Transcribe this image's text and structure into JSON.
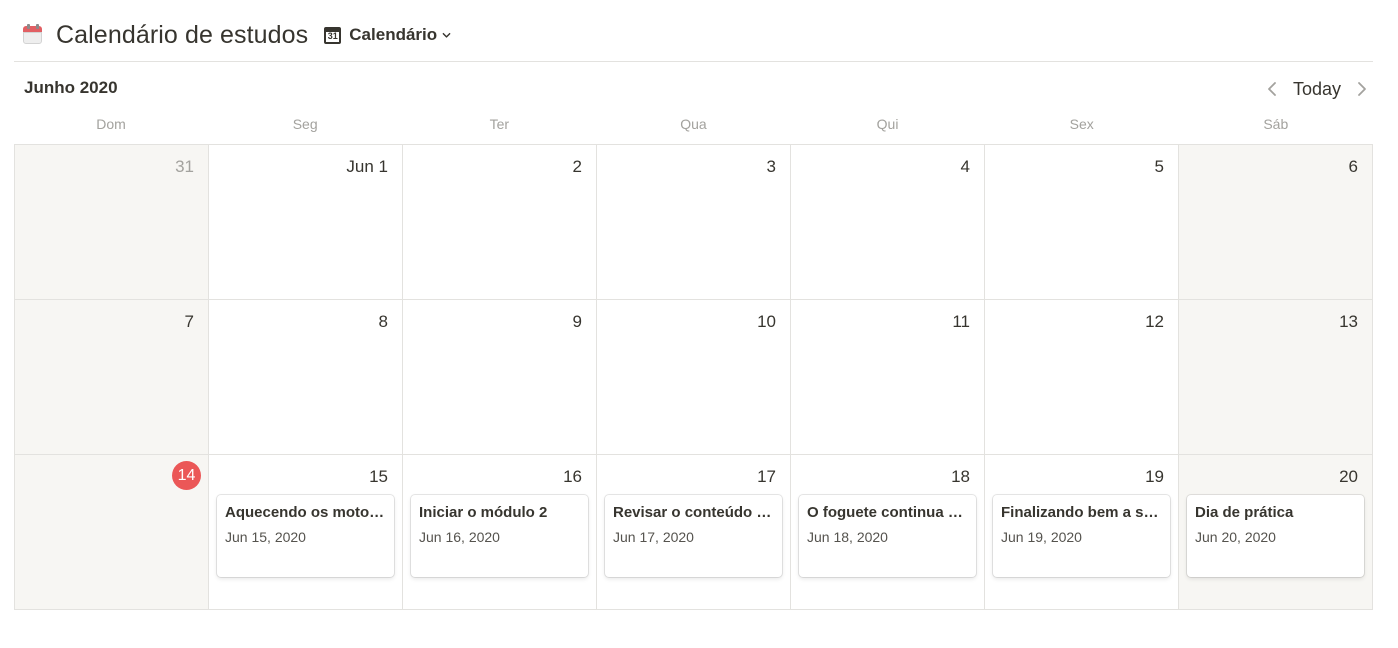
{
  "header": {
    "page_icon": "calendar-emoji-icon",
    "title": "Calendário de estudos",
    "view": {
      "icon": "calendar-view-icon",
      "icon_text": "31",
      "label": "Calendário"
    }
  },
  "calendar": {
    "month_label": "Junho 2020",
    "today_label": "Today",
    "weekdays": [
      "Dom",
      "Seg",
      "Ter",
      "Qua",
      "Qui",
      "Sex",
      "Sáb"
    ],
    "weeks": [
      [
        {
          "day": "31",
          "muted": true
        },
        {
          "day": "Jun 1"
        },
        {
          "day": "2"
        },
        {
          "day": "3"
        },
        {
          "day": "4"
        },
        {
          "day": "5"
        },
        {
          "day": "6"
        }
      ],
      [
        {
          "day": "7"
        },
        {
          "day": "8"
        },
        {
          "day": "9"
        },
        {
          "day": "10"
        },
        {
          "day": "11"
        },
        {
          "day": "12"
        },
        {
          "day": "13"
        }
      ],
      [
        {
          "day": "14",
          "today": true
        },
        {
          "day": "15",
          "event": {
            "title": "Aquecendo os motores",
            "date": "Jun 15, 2020"
          }
        },
        {
          "day": "16",
          "event": {
            "title": "Iniciar o módulo 2",
            "date": "Jun 16, 2020"
          }
        },
        {
          "day": "17",
          "event": {
            "title": "Revisar o conteúdo q...",
            "date": "Jun 17, 2020"
          }
        },
        {
          "day": "18",
          "event": {
            "title": "O foguete continua su...",
            "date": "Jun 18, 2020"
          }
        },
        {
          "day": "19",
          "event": {
            "title": "Finalizando bem a se...",
            "date": "Jun 19, 2020"
          }
        },
        {
          "day": "20",
          "event": {
            "title": "Dia de prática",
            "date": "Jun 20, 2020"
          }
        }
      ]
    ]
  },
  "colors": {
    "today_badge": "#eb5757",
    "weekend_bg": "#f7f6f3",
    "text": "#37352f",
    "muted_text": "#a3a29e"
  }
}
